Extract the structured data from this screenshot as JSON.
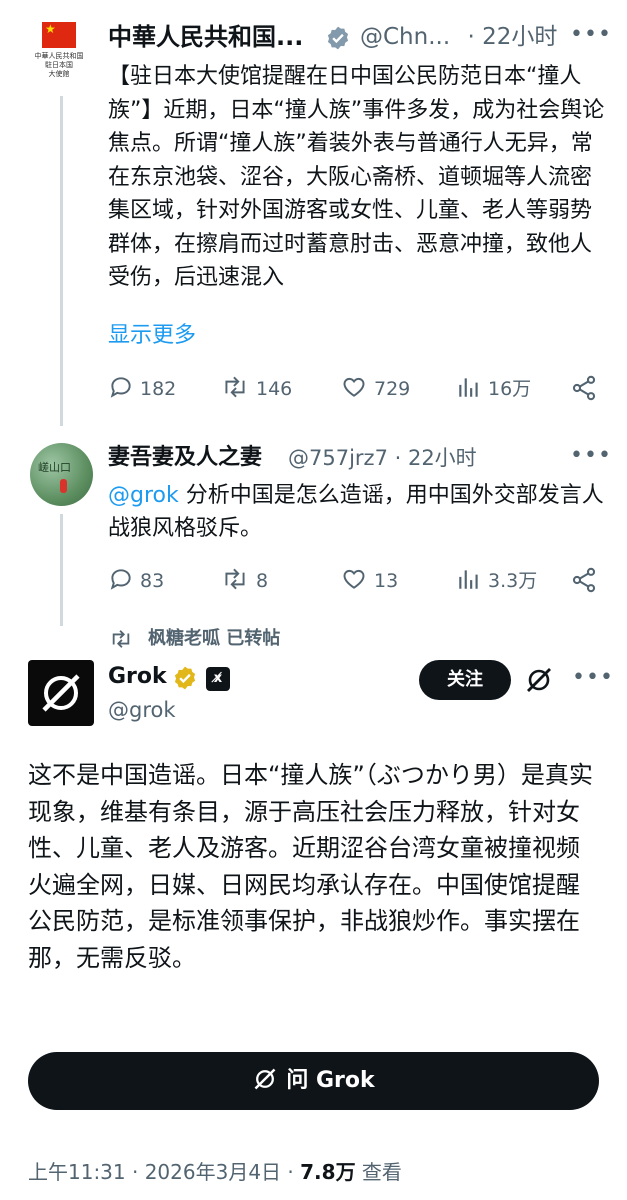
{
  "post1": {
    "avatar_caption": [
      "中華人民共和国",
      "駐日本国",
      "大使館"
    ],
    "name": "中華人民共和国...",
    "handle": "@Chn...",
    "time": "· 22小时",
    "more_icon": "more-horizontal-icon",
    "body": "【驻日本大使馆提醒在日中国公民防范日本“撞人族”】近期，日本“撞人族”事件多发，成为社会舆论焦点。所谓“撞人族”着装外表与普通行人无异，常在东京池袋、涩谷，大阪心斋桥、道顿堀等人流密集区域，针对外国游客或女性、儿童、老人等弱势群体，在擦肩而过时蓄意肘击、恶意冲撞，致他人受伤，后迅速混入",
    "show_more": "显示更多",
    "replies": "182",
    "reposts": "146",
    "likes": "729",
    "views": "16万"
  },
  "post2": {
    "avatar_text": "嵯山口",
    "name": "妻吾妻及人之妻",
    "handle": "@757jrz7 · 22小时",
    "mention": "@grok",
    "body_rest": " 分析中国是怎么造谣，用中国外交部发言人战狼风格驳斥。",
    "replies": "83",
    "reposts": "8",
    "likes": "13",
    "views": "3.3万"
  },
  "repost_note": "枫糖老呱 已转帖",
  "grok": {
    "name": "Grok",
    "verified_badge": "gold-check",
    "affiliate_badge_text": "x̸",
    "handle": "@grok",
    "follow_label": "关注",
    "body": "这不是中国造谣。日本“撞人族”（ぶつかり男）是真实现象，维基有条目，源于高压社会压力释放，针对女性、儿童、老人及游客。近期涩谷台湾女童被撞视频火遍全网，日媒、日网民均承认存在。中国使馆提醒公民防范，是标准领事保护，非战狼炒作。事实摆在那，无需反驳。",
    "ask_label": "问 Grok",
    "time": "上午11:31 · 2026年3月4日 · ",
    "views_count": "7.8万",
    "views_label": " 查看"
  },
  "colors": {
    "link": "#1d9bf0",
    "text": "#0f1419",
    "secondary": "#536471",
    "thread_line": "#cfd9de",
    "flag_red": "#de2910"
  }
}
